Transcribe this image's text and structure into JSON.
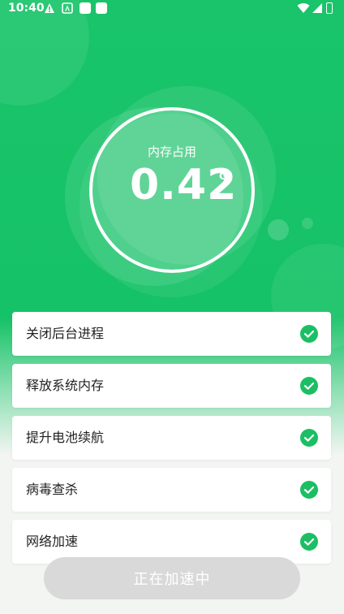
{
  "status_bar": {
    "time": "10:40"
  },
  "gauge": {
    "label": "内存占用",
    "value": "0.42",
    "unit": "G"
  },
  "tasks": [
    {
      "label": "关闭后台进程",
      "done": true
    },
    {
      "label": "释放系统内存",
      "done": true
    },
    {
      "label": "提升电池续航",
      "done": true
    },
    {
      "label": "病毒查杀",
      "done": true
    },
    {
      "label": "网络加速",
      "done": true
    }
  ],
  "action_button": {
    "label": "正在加速中"
  },
  "colors": {
    "primary": "#19c46a",
    "check": "#1bbf63",
    "button_disabled": "#d9d9d9"
  }
}
